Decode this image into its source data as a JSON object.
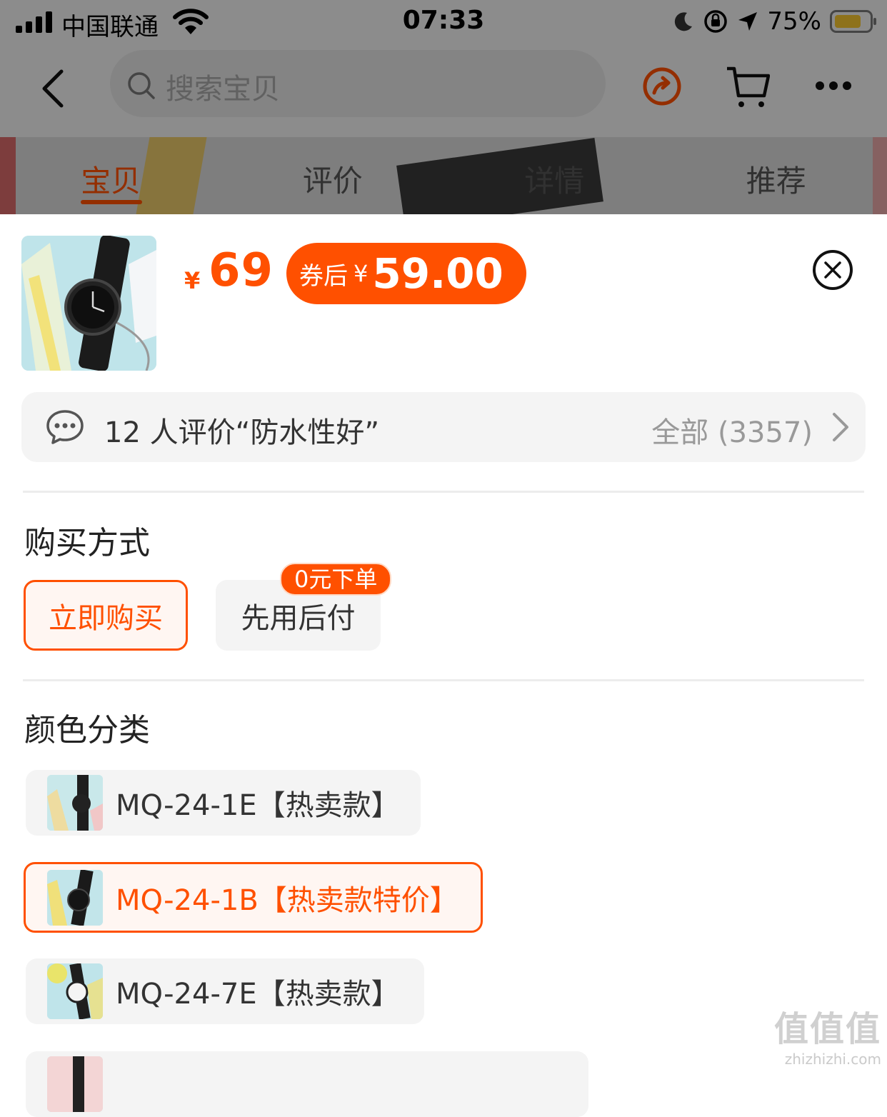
{
  "status_bar": {
    "carrier": "中国联通",
    "time": "07:33",
    "battery": "75%"
  },
  "nav": {
    "search_placeholder": "搜索宝贝"
  },
  "tabs": [
    {
      "label": "宝贝",
      "active": true
    },
    {
      "label": "评价",
      "active": false
    },
    {
      "label": "详情",
      "active": false
    },
    {
      "label": "推荐",
      "active": false
    }
  ],
  "product": {
    "currency": "¥",
    "price": "69",
    "coupon_label": "券后",
    "coupon_currency": "¥",
    "coupon_price": "59.00"
  },
  "review_bar": {
    "summary": "12 人评价“防水性好”",
    "all": "全部 (3357)"
  },
  "purchase": {
    "title": "购买方式",
    "options": [
      {
        "label": "立即购买",
        "selected": true
      },
      {
        "label": "先用后付",
        "selected": false,
        "badge": "0元下单"
      }
    ]
  },
  "color": {
    "title": "颜色分类",
    "options": [
      {
        "label": "MQ-24-1E【热卖款】",
        "selected": false
      },
      {
        "label": "MQ-24-1B【热卖款特价】",
        "selected": true
      },
      {
        "label": "MQ-24-7E【热卖款】",
        "selected": false
      }
    ]
  },
  "watermark": {
    "big": "值值值",
    "small": "zhizhizhi.com"
  },
  "colors": {
    "accent": "#ff5000"
  }
}
